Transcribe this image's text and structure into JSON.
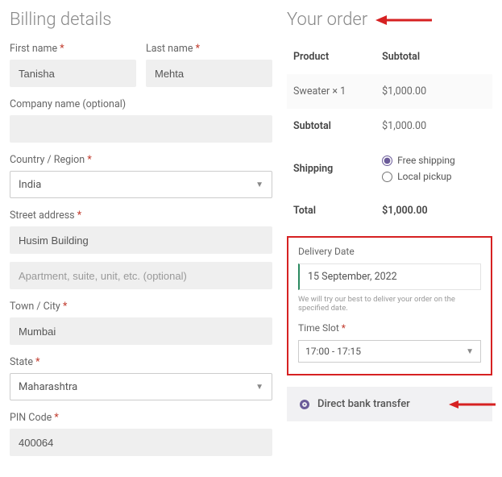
{
  "billing": {
    "heading": "Billing details",
    "first_name_label": "First name",
    "first_name_value": "Tanisha",
    "last_name_label": "Last name",
    "last_name_value": "Mehta",
    "company_label": "Company name (optional)",
    "company_value": "",
    "country_label": "Country / Region",
    "country_value": "India",
    "street_label": "Street address",
    "street_value": "Husim Building",
    "street2_placeholder": "Apartment, suite, unit, etc. (optional)",
    "street2_value": "",
    "town_label": "Town / City",
    "town_value": "Mumbai",
    "state_label": "State",
    "state_value": "Maharashtra",
    "pin_label": "PIN Code",
    "pin_value": "400064",
    "required_marker": "*"
  },
  "order": {
    "heading": "Your order",
    "col_product": "Product",
    "col_subtotal": "Subtotal",
    "line_item_name": "Sweater",
    "line_item_qty": "× 1",
    "line_item_price": "$1,000.00",
    "subtotal_label": "Subtotal",
    "subtotal_value": "$1,000.00",
    "shipping_label": "Shipping",
    "shipping_opts": [
      "Free shipping",
      "Local pickup"
    ],
    "total_label": "Total",
    "total_value": "$1,000.00"
  },
  "delivery": {
    "date_label": "Delivery Date",
    "date_value": "15 September, 2022",
    "note": "We will try our best to deliver your order on the specified date.",
    "slot_label": "Time Slot",
    "slot_value": "17:00 - 17:15"
  },
  "payment": {
    "method_label": "Direct bank transfer"
  }
}
